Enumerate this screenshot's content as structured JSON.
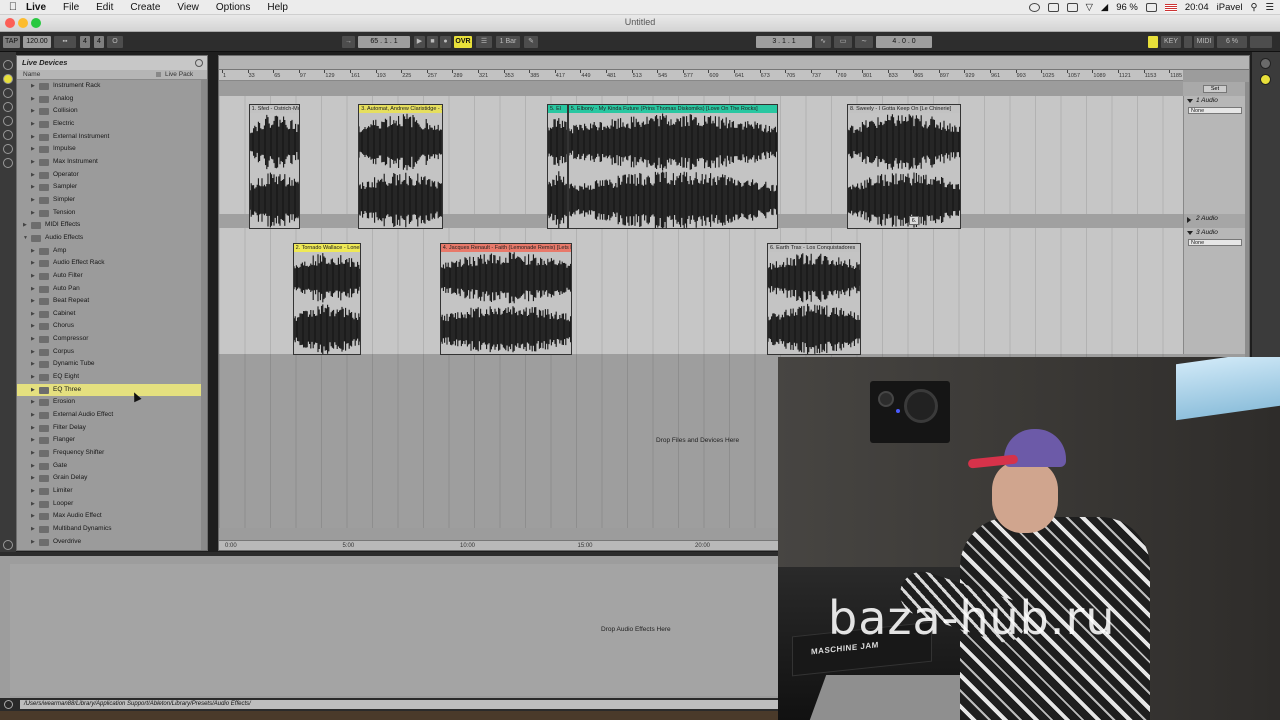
{
  "menubar": {
    "apple": "",
    "items": [
      "Live",
      "File",
      "Edit",
      "Create",
      "View",
      "Options",
      "Help"
    ],
    "battery": "96 %",
    "time": "20:04",
    "user": "iPavel"
  },
  "window": {
    "title": "Untitled"
  },
  "control_bar": {
    "tap": "TAP",
    "tempo": "120.00",
    "sig_num": "4",
    "sig_den": "4",
    "metronome": "O",
    "bar_pos": "65 .  1 .  1",
    "ovr": "OVR",
    "quantize": "1 Bar",
    "loop_start": "3 .  1 .  1",
    "loop_len": "4 .  0 .  0",
    "key": "KEY",
    "midi": "MIDI",
    "cpu": "6 %"
  },
  "browser": {
    "title": "Live Devices",
    "col_name": "Name",
    "col_pack": "Live Pack",
    "items": [
      {
        "label": "Instrument Rack",
        "level": 1
      },
      {
        "label": "Analog",
        "level": 1
      },
      {
        "label": "Collision",
        "level": 1
      },
      {
        "label": "Electric",
        "level": 1
      },
      {
        "label": "External Instrument",
        "level": 1
      },
      {
        "label": "Impulse",
        "level": 1
      },
      {
        "label": "Max Instrument",
        "level": 1
      },
      {
        "label": "Operator",
        "level": 1
      },
      {
        "label": "Sampler",
        "level": 1
      },
      {
        "label": "Simpler",
        "level": 1
      },
      {
        "label": "Tension",
        "level": 1
      },
      {
        "label": "MIDI Effects",
        "level": 0
      },
      {
        "label": "Audio Effects",
        "level": 0,
        "open": true
      },
      {
        "label": "Amp",
        "level": 1
      },
      {
        "label": "Audio Effect Rack",
        "level": 1
      },
      {
        "label": "Auto Filter",
        "level": 1
      },
      {
        "label": "Auto Pan",
        "level": 1
      },
      {
        "label": "Beat Repeat",
        "level": 1
      },
      {
        "label": "Cabinet",
        "level": 1
      },
      {
        "label": "Chorus",
        "level": 1
      },
      {
        "label": "Compressor",
        "level": 1
      },
      {
        "label": "Corpus",
        "level": 1
      },
      {
        "label": "Dynamic Tube",
        "level": 1
      },
      {
        "label": "EQ Eight",
        "level": 1
      },
      {
        "label": "EQ Three",
        "level": 1,
        "selected": true
      },
      {
        "label": "Erosion",
        "level": 1
      },
      {
        "label": "External Audio Effect",
        "level": 1
      },
      {
        "label": "Filter Delay",
        "level": 1
      },
      {
        "label": "Flanger",
        "level": 1
      },
      {
        "label": "Frequency Shifter",
        "level": 1
      },
      {
        "label": "Gate",
        "level": 1
      },
      {
        "label": "Grain Delay",
        "level": 1
      },
      {
        "label": "Limiter",
        "level": 1
      },
      {
        "label": "Looper",
        "level": 1
      },
      {
        "label": "Max Audio Effect",
        "level": 1
      },
      {
        "label": "Multiband Dynamics",
        "level": 1
      },
      {
        "label": "Overdrive",
        "level": 1
      }
    ]
  },
  "arrangement": {
    "ruler_ticks": [
      "1",
      "33",
      "65",
      "97",
      "129",
      "161",
      "193",
      "225",
      "257",
      "289",
      "321",
      "353",
      "385",
      "417",
      "449",
      "481",
      "513",
      "545",
      "577",
      "609",
      "641",
      "673",
      "705",
      "737",
      "769",
      "801",
      "833",
      "865",
      "897",
      "929",
      "961",
      "993",
      "1025",
      "1057",
      "1089",
      "1121",
      "1153",
      "1185"
    ],
    "time_ticks": [
      "0:00",
      "5:00",
      "10:00",
      "15:00",
      "20:00"
    ],
    "drop_files": "Drop Files and Devices Here",
    "set_button": "Set",
    "track1_clips": [
      {
        "title": "1. Sfed - Ostrich-Mo",
        "color": "#c2c2c2",
        "start": 33,
        "end": 97
      },
      {
        "title": "3. Automat, Andrew Claristidge - St",
        "color": "#e6df5e",
        "start": 170,
        "end": 276
      },
      {
        "title": "5. El",
        "color": "#29c7a1",
        "start": 406,
        "end": 432
      },
      {
        "title": "5. Elbony - My Kinda Future (Prins Thomas Diskomiks) [Love On The Rocks]",
        "color": "#29c7a1",
        "start": 432,
        "end": 695
      },
      {
        "title": "8. Sweely - I Gotta Keep On [Le Chinerie]",
        "color": "#c2c2c2",
        "start": 781,
        "end": 924
      }
    ],
    "track3_clips": [
      {
        "title": "2. Tornado Wallace - Lonely",
        "color": "#efe956",
        "start": 88,
        "end": 173
      },
      {
        "title": "4. Jacques Renault - Faith (Lemonade Remix) [Lets Pl",
        "color": "#e8796a",
        "start": 272,
        "end": 437
      },
      {
        "title": "6. Earth Trax - Los Conquistadores",
        "color": "#c2c2c2",
        "start": 681,
        "end": 798
      }
    ],
    "track2_clip_label": "6.",
    "tracks": [
      {
        "name": "1 Audio",
        "input": "None"
      },
      {
        "name": "2 Audio"
      },
      {
        "name": "3 Audio",
        "input": "None"
      }
    ]
  },
  "detail": {
    "drop_text": "Drop Audio Effects Here"
  },
  "status": {
    "path": "/Users/wearman88/Library/Application Support/Ableton/Library/Presets/Audio Effects/"
  },
  "webcam": {
    "watermark": "baza-hub.ru",
    "device_label": "MASCHINE JAM"
  },
  "colors": {
    "accent": "#e8e03a",
    "selection": "#e5e07f"
  }
}
